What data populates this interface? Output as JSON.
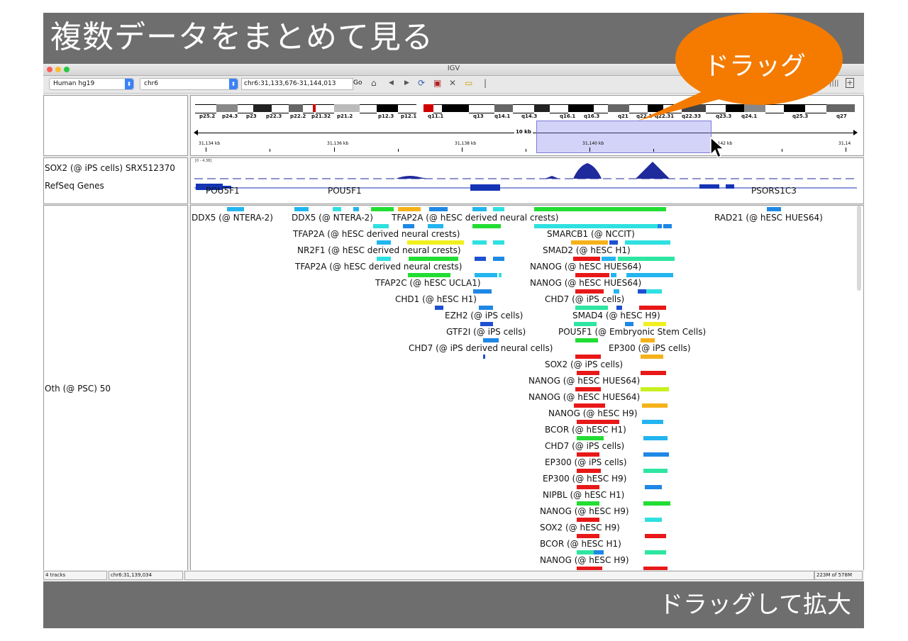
{
  "slide": {
    "title": "複数データをまとめて見る",
    "footer": "ドラッグして拡大",
    "callout": "ドラッグ"
  },
  "window": {
    "title": "IGV"
  },
  "toolbar": {
    "genome": "Human hg19",
    "chromosome": "chr6",
    "locus": "chr6:31,133,676-31,144,013",
    "go": "Go"
  },
  "ideogram": {
    "bands": [
      "p25.2",
      "p24.3",
      "p23",
      "p22.3",
      "p22.2",
      "p21.32",
      "p21.2",
      "p12.3",
      "p12.1",
      "q11.1",
      "q13",
      "q14.1",
      "q14.3",
      "q16.1",
      "q16.3",
      "q21",
      "q22.1",
      "q22.31",
      "q22.33",
      "q23.3",
      "q24.1",
      "q25.3",
      "q27"
    ]
  },
  "ruler": {
    "span": "10 kb",
    "ticks": [
      "31,134 kb",
      "31,136 kb",
      "31,138 kb",
      "31,140 kb",
      "31,142 kb",
      "31,14"
    ]
  },
  "tracks": {
    "sox2": "SOX2 (@ iPS cells) SRX512370",
    "refseq": "RefSeq Genes",
    "sox2_range": "[0 - 4.38]",
    "genes": [
      "POU5F1",
      "POU5F1",
      "PSORS1C3"
    ],
    "oth": "Oth (@ PSC) 50"
  },
  "peaks": [
    "DDX5 (@ NTERA-2)",
    "DDX5 (@ NTERA-2)",
    "TFAP2A (@ hESC derived neural crests)",
    "RAD21 (@ hESC HUES64)",
    "TFAP2A (@ hESC derived neural crests)",
    "SMARCB1 (@ NCCIT)",
    "NR2F1 (@ hESC derived neural crests)",
    "SMAD2 (@ hESC H1)",
    "TFAP2A (@ hESC derived neural crests)",
    "NANOG (@ hESC HUES64)",
    "TFAP2C (@ hESC UCLA1)",
    "NANOG (@ hESC HUES64)",
    "CHD1 (@ hESC H1)",
    "CHD7 (@ iPS cells)",
    "EZH2 (@ iPS cells)",
    "SMAD4 (@ hESC H9)",
    "GTF2I (@ iPS cells)",
    "POU5F1 (@ Embryonic Stem Cells)",
    "CHD7 (@ iPS derived neural cells)",
    "EP300 (@ iPS cells)",
    "SOX2 (@ iPS cells)",
    "NANOG (@ hESC HUES64)",
    "NANOG (@ hESC HUES64)",
    "NANOG (@ hESC H9)",
    "BCOR (@ hESC H1)",
    "CHD7 (@ iPS cells)",
    "EP300 (@ iPS cells)",
    "EP300 (@ hESC H9)",
    "NIPBL (@ hESC H1)",
    "NANOG (@ hESC H9)",
    "SOX2 (@ hESC H9)",
    "BCOR (@ hESC H1)",
    "NANOG (@ hESC H9)"
  ],
  "status": {
    "tracks": "4 tracks",
    "position": "chr6:31,139,034",
    "memory": "223M of 578M"
  },
  "colors": {
    "header_bg": "#6e6e6e",
    "callout": "#f47b00",
    "coverage": "#1f2a9c",
    "gene": "#1434b4",
    "selection": "#8c8cf0"
  }
}
